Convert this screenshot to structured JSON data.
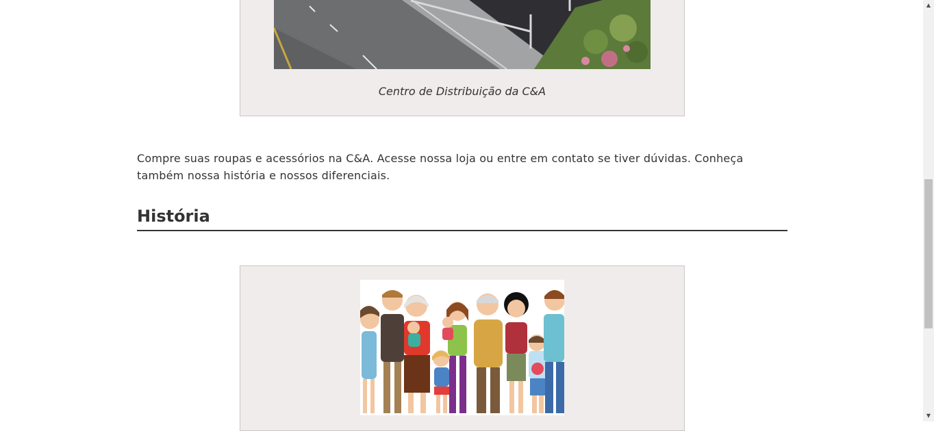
{
  "figure1": {
    "image_alt": "Centro de Distribuição da C&A",
    "caption": "Centro de Distribuição da C&A"
  },
  "intro_paragraph": "Compre suas roupas e acessórios na C&A. Acesse nossa loja ou entre em contato se tiver dúvidas. Conheça também nossa história e nossos diferenciais.",
  "section": {
    "title": "História"
  },
  "figure2": {
    "image_alt": "family illustration"
  },
  "scrollbar": {
    "up_icon": "triangle-up",
    "down_icon": "triangle-down"
  }
}
